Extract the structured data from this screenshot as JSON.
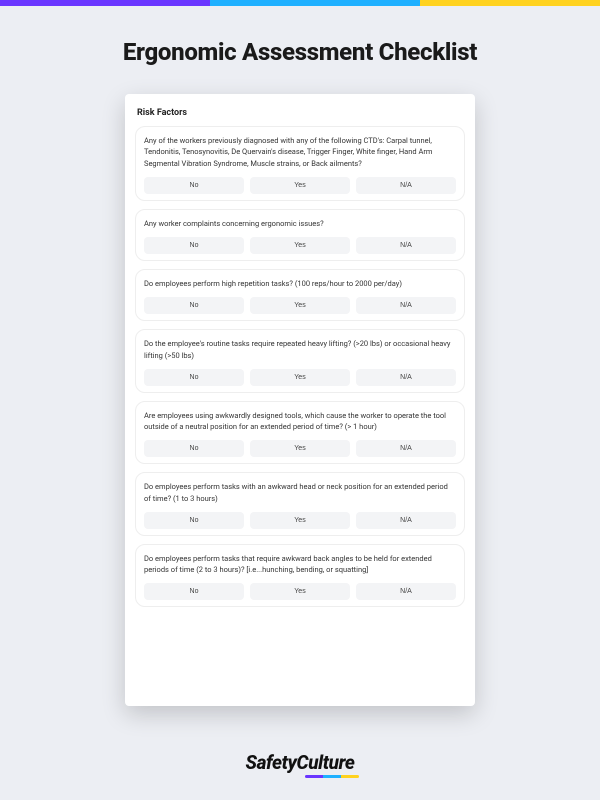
{
  "page_title": "Ergonomic Assessment Checklist",
  "section_title": "Risk Factors",
  "options": {
    "no": "No",
    "yes": "Yes",
    "na": "N/A"
  },
  "questions": [
    "Any of the workers previously diagnosed with any of the following CTD's: Carpal tunnel, Tendonitis, Tenosynovitis, De Quervain's disease, Trigger Finger, White finger, Hand Arm Segmental Vibration Syndrome, Muscle strains, or Back ailments?",
    "Any worker complaints concerning ergonomic issues?",
    "Do employees perform high repetition tasks? (100 reps/hour to 2000 per/day)",
    "Do the employee's routine tasks require repeated heavy lifting? (>20 lbs) or occasional heavy lifting (>50 lbs)",
    "Are employees using awkwardly designed tools, which cause the worker to operate the tool outside of a neutral position for an extended period of time? (> 1 hour)",
    "Do employees perform tasks with an awkward head or neck position for an extended period of time? (1 to 3 hours)",
    "Do employees perform tasks that require awkward back angles to be held for extended periods of time (2 to 3 hours)? [i.e...hunching, bending, or squatting]"
  ],
  "brand": "SafetyCulture"
}
